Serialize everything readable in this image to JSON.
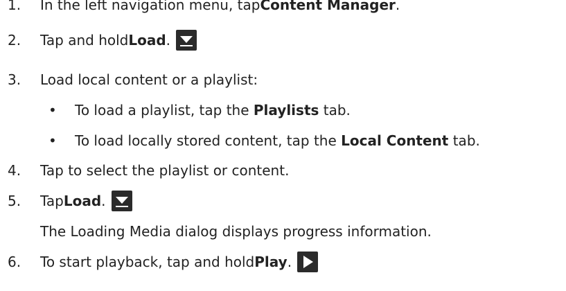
{
  "steps": [
    {
      "num": "1.",
      "pre": "In the left navigation menu, tap ",
      "bold": "Content Manager",
      "post": "."
    },
    {
      "num": "2.",
      "pre": "Tap and hold ",
      "bold": "Load",
      "post": ".",
      "icon": "load-icon"
    },
    {
      "num": "3.",
      "text": "Load local content or a playlist:"
    },
    {
      "num": "4.",
      "text": "Tap to select the playlist or content."
    },
    {
      "num": "5.",
      "pre": "Tap ",
      "bold": "Load",
      "post": ".",
      "icon": "load-icon",
      "note": "The Loading Media dialog displays progress information."
    },
    {
      "num": "6.",
      "pre": "To start playback, tap and hold ",
      "bold": "Play",
      "post": ".",
      "icon": "play-icon"
    }
  ],
  "substeps": [
    {
      "bullet": "•",
      "pre": "To load a playlist, tap the ",
      "bold": "Playlists",
      "post": " tab."
    },
    {
      "bullet": "•",
      "pre": "To load locally stored content, tap the ",
      "bold": "Local Content",
      "post": " tab."
    }
  ],
  "icon_colors": {
    "background": "#2b2b2b",
    "glyph": "#ffffff"
  }
}
